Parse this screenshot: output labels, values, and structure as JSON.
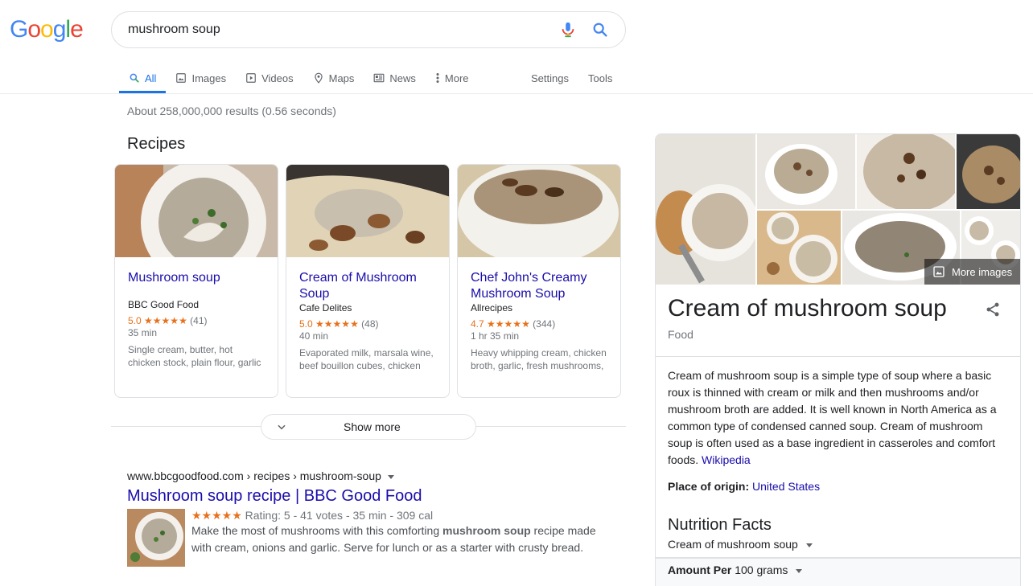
{
  "logo": {
    "text": "Google"
  },
  "search": {
    "query": "mushroom soup"
  },
  "tabs": [
    {
      "label": "All",
      "icon": "search-icon"
    },
    {
      "label": "Images",
      "icon": "image-icon"
    },
    {
      "label": "Videos",
      "icon": "video-icon"
    },
    {
      "label": "Maps",
      "icon": "map-pin-icon"
    },
    {
      "label": "News",
      "icon": "news-icon"
    },
    {
      "label": "More",
      "icon": "more-vert-icon"
    }
  ],
  "tools": {
    "settings": "Settings",
    "tools": "Tools"
  },
  "stats": "About 258,000,000 results (0.56 seconds)",
  "recipes": {
    "title": "Recipes",
    "cards": [
      {
        "title": "Mushroom soup",
        "source": "BBC Good Food",
        "rating": "5.0",
        "stars": "★★★★★",
        "votes": "(41)",
        "time": "35 min",
        "ingredients": "Single cream, butter, hot chicken stock, plain flour, garlic"
      },
      {
        "title": "Cream of Mushroom Soup",
        "source": "Cafe Delites",
        "rating": "5.0",
        "stars": "★★★★★",
        "votes": "(48)",
        "time": "40 min",
        "ingredients": "Evaporated milk, marsala wine, beef bouillon cubes, chicken"
      },
      {
        "title": "Chef John's Creamy Mushroom Soup",
        "source": "Allrecipes",
        "rating": "4.7",
        "stars": "★★★★★",
        "votes": "(344)",
        "time": "1 hr 35 min",
        "ingredients": "Heavy whipping cream, chicken broth, garlic, fresh mushrooms,"
      }
    ],
    "show_more": "Show more"
  },
  "result": {
    "cite": "www.bbcgoodfood.com › recipes › mushroom-soup",
    "title": "Mushroom soup recipe | BBC Good Food",
    "stars": "★★★★★",
    "meta": "Rating: 5 - 41 votes - 35 min - 309 cal",
    "snippet_pre": "Make the most of mushrooms with this comforting ",
    "snippet_bold": "mushroom soup",
    "snippet_post": " recipe made with cream, onions and garlic. Serve for lunch or as a starter with crusty bread."
  },
  "knowledge_panel": {
    "more_images": "More images",
    "title": "Cream of mushroom soup",
    "subtitle": "Food",
    "description": "Cream of mushroom soup is a simple type of soup where a basic roux is thinned with cream or milk and then mushrooms and/or mushroom broth are added. It is well known in North America as a common type of condensed canned soup. Cream of mushroom soup is often used as a base ingredient in casseroles and comfort foods. ",
    "description_link": "Wikipedia",
    "origin_label": "Place of origin: ",
    "origin_value": "United States",
    "nutrition_title": "Nutrition Facts",
    "nutrition_item": "Cream of mushroom soup",
    "amount_label": "Amount Per",
    "amount_value": " 100 grams"
  },
  "colors": {
    "link": "#1a0dab",
    "accent": "#1a73e8",
    "star": "#e7711b"
  }
}
